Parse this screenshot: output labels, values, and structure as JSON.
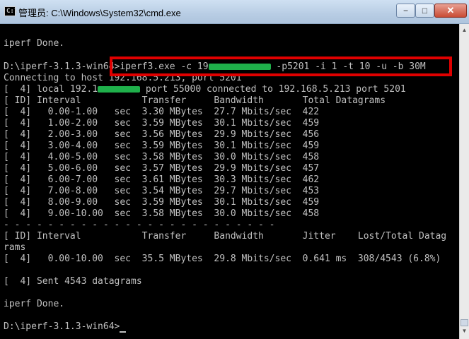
{
  "window": {
    "title": "管理员: C:\\Windows\\System32\\cmd.exe",
    "icon": "terminal-icon",
    "buttons": {
      "minimize": "−",
      "maximize": "□",
      "close": "✕"
    }
  },
  "console": {
    "lines": [
      "iperf Done.",
      "",
      "D:\\iperf-3.1.3-win64>iperf3.exe -c 19",
      "Connecting to host 192.168.5.213, port 5201",
      "[  4] local 192.1",
      "[ ID] Interval           Transfer     Bandwidth       Total Datagrams",
      "[  4]   0.00-1.00   sec  3.30 MBytes  27.7 Mbits/sec  422",
      "[  4]   1.00-2.00   sec  3.59 MBytes  30.1 Mbits/sec  459",
      "[  4]   2.00-3.00   sec  3.56 MBytes  29.9 Mbits/sec  456",
      "[  4]   3.00-4.00   sec  3.59 MBytes  30.1 Mbits/sec  459",
      "[  4]   4.00-5.00   sec  3.58 MBytes  30.0 Mbits/sec  458",
      "[  4]   5.00-6.00   sec  3.57 MBytes  29.9 Mbits/sec  457",
      "[  4]   6.00-7.00   sec  3.61 MBytes  30.3 Mbits/sec  462",
      "[  4]   7.00-8.00   sec  3.54 MBytes  29.7 Mbits/sec  453",
      "[  4]   8.00-9.00   sec  3.59 MBytes  30.1 Mbits/sec  459",
      "[  4]   9.00-10.00  sec  3.58 MBytes  30.0 Mbits/sec  458",
      "- - - - - - - - - - - - - - - - - - - - - - - - -",
      "[ ID] Interval           Transfer     Bandwidth       Jitter    Lost/Total Datag",
      "rams",
      "[  4]   0.00-10.00  sec  35.5 MBytes  29.8 Mbits/sec  0.641 ms  308/4543 (6.8%)",
      "",
      "[  4] Sent 4543 datagrams",
      "",
      "iperf Done.",
      "",
      "D:\\iperf-3.1.3-win64>"
    ],
    "cmd_suffix": " -p5201 -i 1 -t 10 -u -b 30M",
    "local_suffix": " port 55000 connected to 192.168.5.213 port 5201",
    "highlight_color": "#e00000",
    "redaction_color": "#1fb04b",
    "text_color": "#c0c0c0",
    "background_color": "#000000"
  }
}
